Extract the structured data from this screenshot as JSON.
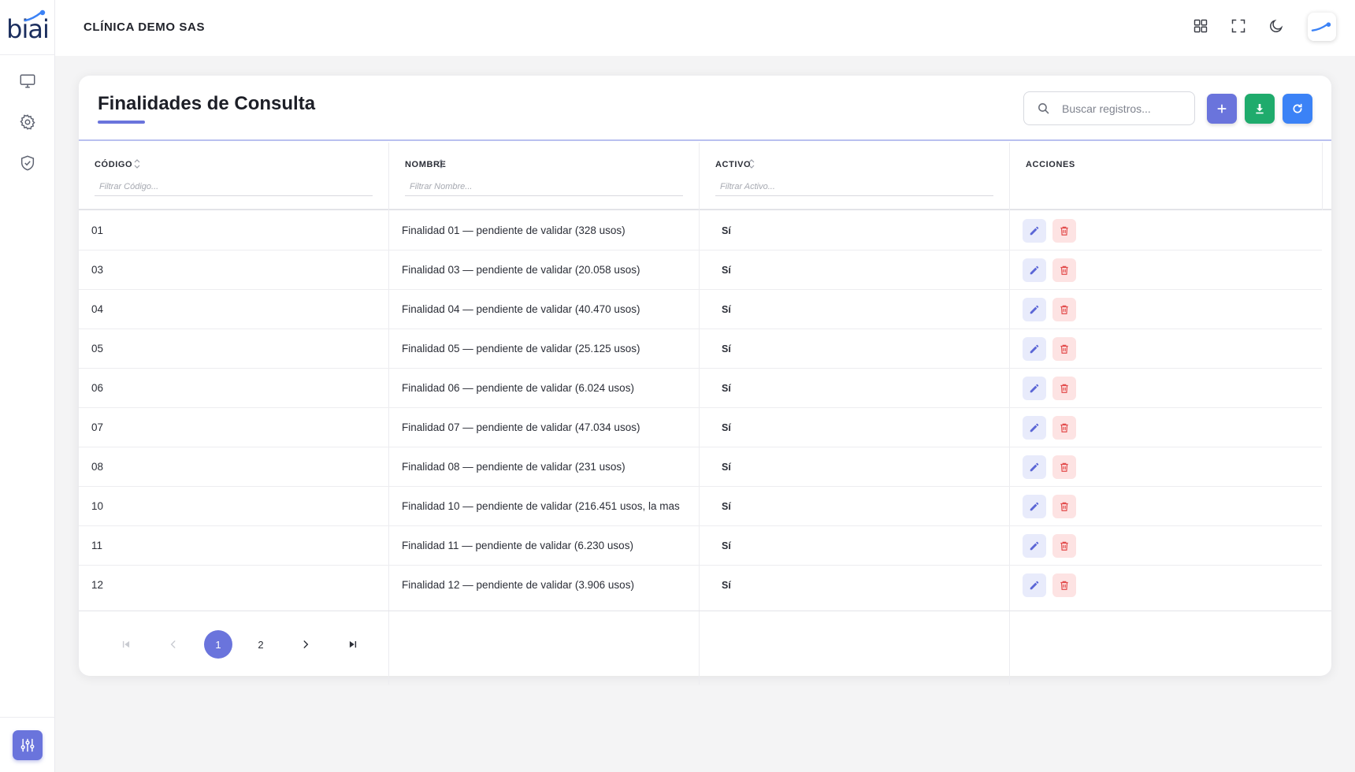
{
  "sidebar": {
    "logo_text": "biai",
    "items": [
      {
        "name": "monitor-icon"
      },
      {
        "name": "gear-icon"
      },
      {
        "name": "shield-check-icon"
      }
    ],
    "bottom_button": "sliders-icon"
  },
  "topbar": {
    "clinic_name": "CLÍNICA DEMO SAS",
    "icons": [
      "grid-icon",
      "fullscreen-icon",
      "moon-icon",
      "avatar"
    ]
  },
  "card": {
    "title": "Finalidades de Consulta",
    "search": {
      "placeholder": "Buscar registros..."
    },
    "buttons": {
      "add": "plus-icon",
      "export": "download-icon",
      "refresh": "refresh-icon"
    }
  },
  "table": {
    "columns": [
      {
        "label": "CÓDIGO",
        "filter_placeholder": "Filtrar Código..."
      },
      {
        "label": "NOMBRE",
        "filter_placeholder": "Filtrar Nombre..."
      },
      {
        "label": "ACTIVO",
        "filter_placeholder": "Filtrar Activo..."
      },
      {
        "label": "ACCIONES"
      }
    ],
    "rows": [
      {
        "code": "01",
        "name": "Finalidad 01 — pendiente de validar (328 usos)",
        "active": "Sí"
      },
      {
        "code": "03",
        "name": "Finalidad 03 — pendiente de validar (20.058 usos)",
        "active": "Sí"
      },
      {
        "code": "04",
        "name": "Finalidad 04 — pendiente de validar (40.470 usos)",
        "active": "Sí"
      },
      {
        "code": "05",
        "name": "Finalidad 05 — pendiente de validar (25.125 usos)",
        "active": "Sí"
      },
      {
        "code": "06",
        "name": "Finalidad 06 — pendiente de validar (6.024 usos)",
        "active": "Sí"
      },
      {
        "code": "07",
        "name": "Finalidad 07 — pendiente de validar (47.034 usos)",
        "active": "Sí"
      },
      {
        "code": "08",
        "name": "Finalidad 08 — pendiente de validar (231 usos)",
        "active": "Sí"
      },
      {
        "code": "10",
        "name": "Finalidad 10 — pendiente de validar (216.451 usos, la mas",
        "active": "Sí"
      },
      {
        "code": "11",
        "name": "Finalidad 11 — pendiente de validar (6.230 usos)",
        "active": "Sí"
      },
      {
        "code": "12",
        "name": "Finalidad 12 — pendiente de validar (3.906 usos)",
        "active": "Sí"
      }
    ]
  },
  "pagination": {
    "pages": [
      "1",
      "2"
    ],
    "current": "1"
  },
  "colors": {
    "accent": "#6a74dc",
    "success": "#1fab6c",
    "info": "#3b82f6",
    "danger": "#e24b4b"
  }
}
